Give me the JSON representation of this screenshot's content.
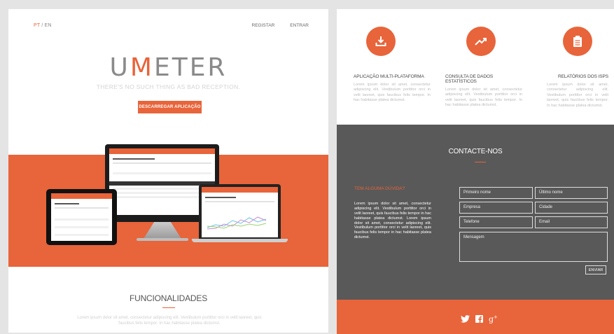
{
  "left": {
    "lang": {
      "pt": "PT",
      "sep": " / ",
      "en": "EN"
    },
    "nav": {
      "register": "REGISTAR",
      "login": "ENTRAR"
    },
    "logo": {
      "u": "U",
      "m": "M",
      "rest": "ETER"
    },
    "tagline": "THERE'S NO SUCH THING AS BAD RECEPTION.",
    "download_button": "DESCARREGAR APLICAÇÃO",
    "features_title": "FUNCIONALIDADES",
    "features_text": "Lorem ipsum dolor sit amet, consectetur adipiscing elit. Vestibulum porttitor orci in velit laoreet, quis faucibus felis tempor. In hac habitasse platea dictumst."
  },
  "right": {
    "features": [
      {
        "icon": "download-icon",
        "title": "APLICAÇÃO MULTI-PLATAFORMA",
        "text": "Lorem ipsum dolor sit amet, consectetur adipiscing elit. Vestibulum porttitor orci in velit laoreet, quis faucibus felis tempor. In hac habitasse platea dictumst."
      },
      {
        "icon": "trend-icon",
        "title": "CONSULTA DE DADOS ESTATÍSTICOS",
        "text": "Lorem ipsum dolor sit amet, consectetur adipiscing elit. Vestibulum porttitor orci in velit laoreet, quis faucibus felis tempor. In hac habitasse platea dictumst."
      },
      {
        "icon": "clipboard-icon",
        "title": "RELATÓRIOS DOS ISPS",
        "text": "Lorem ipsum dolor sit amet, consectetur adipiscing elit. Vestibulum porttitor orci in velit laoreet, quis faucibus felis tempor. In hac habitasse platea dictumst."
      }
    ],
    "contact_title": "CONTACTE-NOS",
    "question": "TEM ALGUMA DÚVIDA?",
    "question_text": "Lorem ipsum dolor sit amet, consectetur adipiscing elit. Vestibulum porttitor orci in velit laoreet, quis faucibus felis tempor in hac habitasse platea dictumst. Lorem ipsum dolor sit amet, consectetur adipiscing elit. Vestibulum porttitor orci in velit laoreet, quis faucibus felis tempor in hac habitasse platea dictumst.",
    "form": {
      "first_name": "Primeiro nome",
      "last_name": "Último nome",
      "company": "Empresa",
      "city": "Cidade",
      "phone": "Telefone",
      "email": "Email",
      "message": "Mensagem",
      "send": "ENVIAR"
    },
    "social": [
      "twitter-icon",
      "facebook-icon",
      "google-plus-icon"
    ]
  },
  "colors": {
    "accent": "#e8643a",
    "dark": "#595959"
  }
}
